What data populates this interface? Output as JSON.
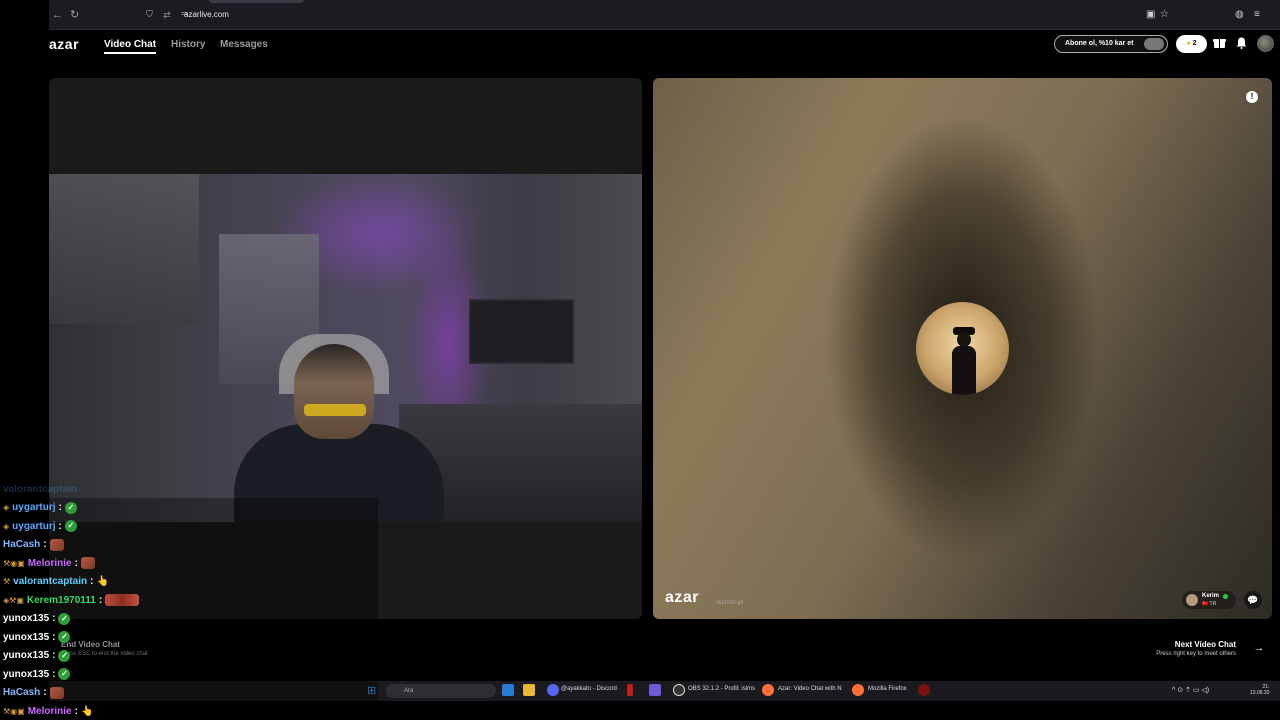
{
  "browser": {
    "nav_back": "←",
    "nav_forward": "→",
    "reload": "↻",
    "url_icons": "⛉ ⇄ ▭",
    "url": "azarlive.com",
    "right_icons": [
      "▣",
      "☆",
      "◍",
      "≡"
    ]
  },
  "app": {
    "logo": "azar",
    "nav": [
      {
        "label": "Video Chat",
        "active": true
      },
      {
        "label": "History",
        "active": false
      },
      {
        "label": "Messages",
        "active": false
      }
    ],
    "subscribe_label": "Abone ol, %10 kar et",
    "coins": "2",
    "coin_glyph": "●"
  },
  "stranger": {
    "watermark": "azar",
    "watermark_id": "16y11AX-g8",
    "user_name": "Kerim",
    "user_country": "🇹🇷 TR",
    "report_glyph": "!",
    "chat_glyph": "💬"
  },
  "controls": {
    "end_title": "End Video Chat",
    "end_hint": "Press ESC to end the video chat",
    "next_title": "Next Video Chat",
    "next_hint": "Press right key to meet others",
    "next_arrow": "→"
  },
  "taskbar": {
    "start_glyph": "⊞",
    "search_placeholder": "Ara",
    "items": [
      "@ayakkabı - Discord",
      "OBS 32.1.2 - Profil: isims",
      "Azar: Video Chat with N",
      "Mozilla Firefox"
    ],
    "tray_icons": "^ ⊙ ⇡ ▭ ◁)",
    "time": "21:",
    "date": "13.08.20"
  },
  "chat": {
    "lines": [
      {
        "badges": "",
        "nick": "valorantcaptain",
        "color": "#5aa7ff",
        "emote": "none",
        "faded": true
      },
      {
        "badges": "◈",
        "nick": "uygarturj",
        "color": "#5aa7ff",
        "emote": "check",
        "faded": false
      },
      {
        "badges": "◈",
        "nick": "uygarturj",
        "color": "#5aa7ff",
        "emote": "check",
        "faded": false
      },
      {
        "badges": "",
        "nick": "HaCash",
        "color": "#8ab4ff",
        "emote": "face",
        "faded": false
      },
      {
        "badges": "⚒◉▣",
        "nick": "Melorinie",
        "color": "#c86bff",
        "emote": "face",
        "faded": false
      },
      {
        "badges": "⚒",
        "nick": "valorantcaptain",
        "color": "#5ad0ff",
        "emote": "hand",
        "faded": false
      },
      {
        "badges": "◈⚒▣",
        "nick": "Kerem1970111",
        "color": "#3ad86b",
        "emote": "wide",
        "faded": false
      },
      {
        "badges": "",
        "nick": "yunox135",
        "color": "#ffffff",
        "emote": "check",
        "faded": false
      },
      {
        "badges": "",
        "nick": "yunox135",
        "color": "#ffffff",
        "emote": "check",
        "faded": false
      },
      {
        "badges": "",
        "nick": "yunox135",
        "color": "#ffffff",
        "emote": "check",
        "faded": false
      },
      {
        "badges": "",
        "nick": "yunox135",
        "color": "#ffffff",
        "emote": "check",
        "faded": false
      },
      {
        "badges": "",
        "nick": "HaCash",
        "color": "#8ab4ff",
        "emote": "face",
        "faded": false
      },
      {
        "badges": "⚒◉▣",
        "nick": "Melorinie",
        "color": "#c86bff",
        "emote": "hand",
        "faded": false
      }
    ],
    "colon": ":",
    "check_glyph": "✓",
    "hand_glyph": "👆"
  },
  "icons": {
    "bell": "bell-icon",
    "gift": "gift-icon",
    "shield": "shield-icon",
    "search": "search-icon"
  }
}
